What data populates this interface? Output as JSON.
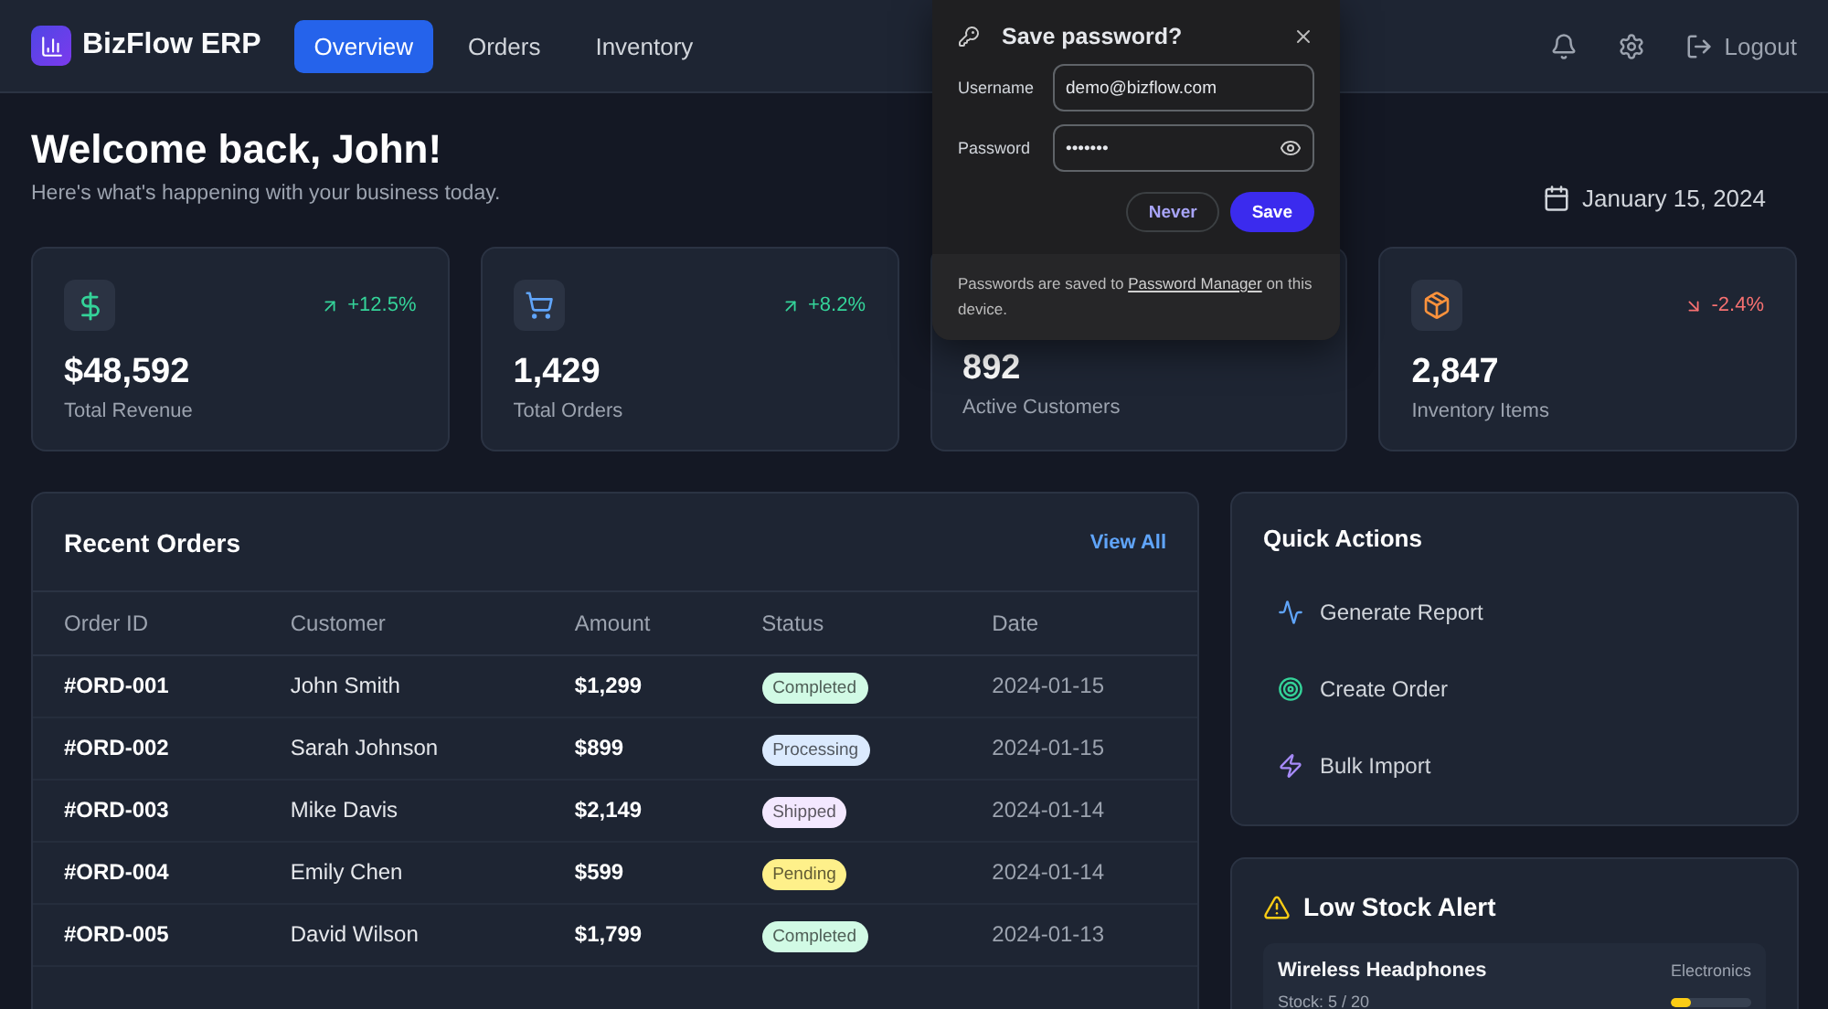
{
  "brand": {
    "name": "BizFlow ERP"
  },
  "nav": [
    {
      "label": "Overview",
      "selected": true
    },
    {
      "label": "Orders",
      "selected": false
    },
    {
      "label": "Inventory",
      "selected": false
    }
  ],
  "header_actions": {
    "logout": "Logout"
  },
  "welcome": {
    "title": "Welcome back, John!",
    "subtitle": "Here's what's happening with your business today.",
    "date": "January 15, 2024"
  },
  "stats": [
    {
      "kind": "dollar",
      "value": "$48,592",
      "label": "Total Revenue",
      "change": "+12.5%",
      "rising": true
    },
    {
      "kind": "cart",
      "value": "1,429",
      "label": "Total Orders",
      "change": "+8.2%",
      "rising": true
    },
    {
      "kind": "hidden",
      "value": "892",
      "label": "Active Customers"
    },
    {
      "kind": "box",
      "value": "2,847",
      "label": "Inventory Items",
      "change": "-2.4%",
      "rising": false
    }
  ],
  "recent_orders": {
    "title": "Recent Orders",
    "view_all": "View All",
    "columns": [
      "Order ID",
      "Customer",
      "Amount",
      "Status",
      "Date"
    ],
    "rows": [
      {
        "id": "#ORD-001",
        "customer": "John Smith",
        "amount": "$1,299",
        "status": "Completed",
        "color": "#d1fae5",
        "date": "2024-01-15"
      },
      {
        "id": "#ORD-002",
        "customer": "Sarah Johnson",
        "amount": "$899",
        "status": "Processing",
        "color": "#dbeafe",
        "date": "2024-01-15"
      },
      {
        "id": "#ORD-003",
        "customer": "Mike Davis",
        "amount": "$2,149",
        "status": "Shipped",
        "color": "#f3e8ff",
        "date": "2024-01-14"
      },
      {
        "id": "#ORD-004",
        "customer": "Emily Chen",
        "amount": "$599",
        "status": "Pending",
        "color": "#fef08a",
        "date": "2024-01-14"
      },
      {
        "id": "#ORD-005",
        "customer": "David Wilson",
        "amount": "$1,799",
        "status": "Completed",
        "color": "#d1fae5",
        "date": "2024-01-13"
      }
    ]
  },
  "quick_actions": {
    "title": "Quick Actions",
    "items": [
      {
        "kind": "activity",
        "label": "Generate Report"
      },
      {
        "kind": "target",
        "label": "Create Order"
      },
      {
        "kind": "zap",
        "label": "Bulk Import"
      }
    ]
  },
  "low_stock": {
    "title": "Low Stock Alert",
    "items": [
      {
        "name": "Wireless Headphones",
        "category": "Electronics",
        "stock": "Stock: 5 / 20",
        "level": 0.25
      }
    ]
  },
  "save_password_popup": {
    "title": "Save password?",
    "username_label": "Username",
    "username": "demo@bizflow.com",
    "password_label": "Password",
    "password": "•••••••",
    "never": "Never",
    "save": "Save",
    "note": "Passwords are saved to",
    "note_link": "Password Manager",
    "note_end": "on this device."
  }
}
